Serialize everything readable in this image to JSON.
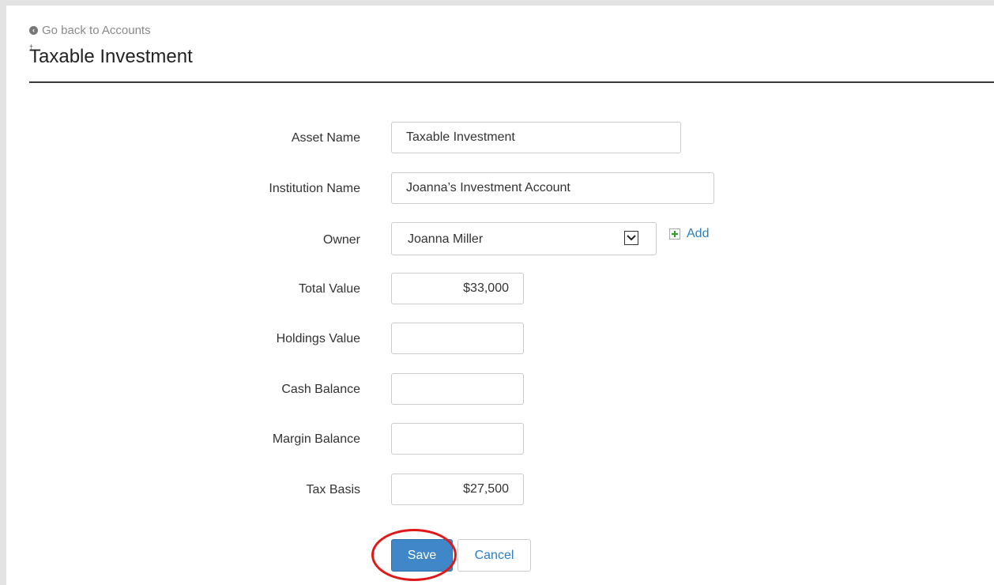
{
  "nav": {
    "back_label": "Go back to Accounts",
    "back_icon": "circle-arrow-left-icon"
  },
  "page": {
    "title": "Taxable Investment",
    "title_mark": "†"
  },
  "form": {
    "asset_name": {
      "label": "Asset Name",
      "value": "Taxable Investment"
    },
    "institution_name": {
      "label": "Institution Name",
      "value": "Joanna’s Investment Account"
    },
    "owner": {
      "label": "Owner",
      "value": "Joanna Miller",
      "add_label": "Add",
      "add_icon": "plus-icon"
    },
    "total_value": {
      "label": "Total Value",
      "value": "$33,000"
    },
    "holdings_value": {
      "label": "Holdings Value",
      "value": ""
    },
    "cash_balance": {
      "label": "Cash Balance",
      "value": ""
    },
    "margin_balance": {
      "label": "Margin Balance",
      "value": ""
    },
    "tax_basis": {
      "label": "Tax Basis",
      "value": "$27,500"
    }
  },
  "actions": {
    "save_label": "Save",
    "cancel_label": "Cancel"
  },
  "colors": {
    "primary_button": "#3f87c9",
    "link": "#2a7fc4",
    "highlight": "#e01818",
    "add_icon_green": "#2aa52a"
  }
}
